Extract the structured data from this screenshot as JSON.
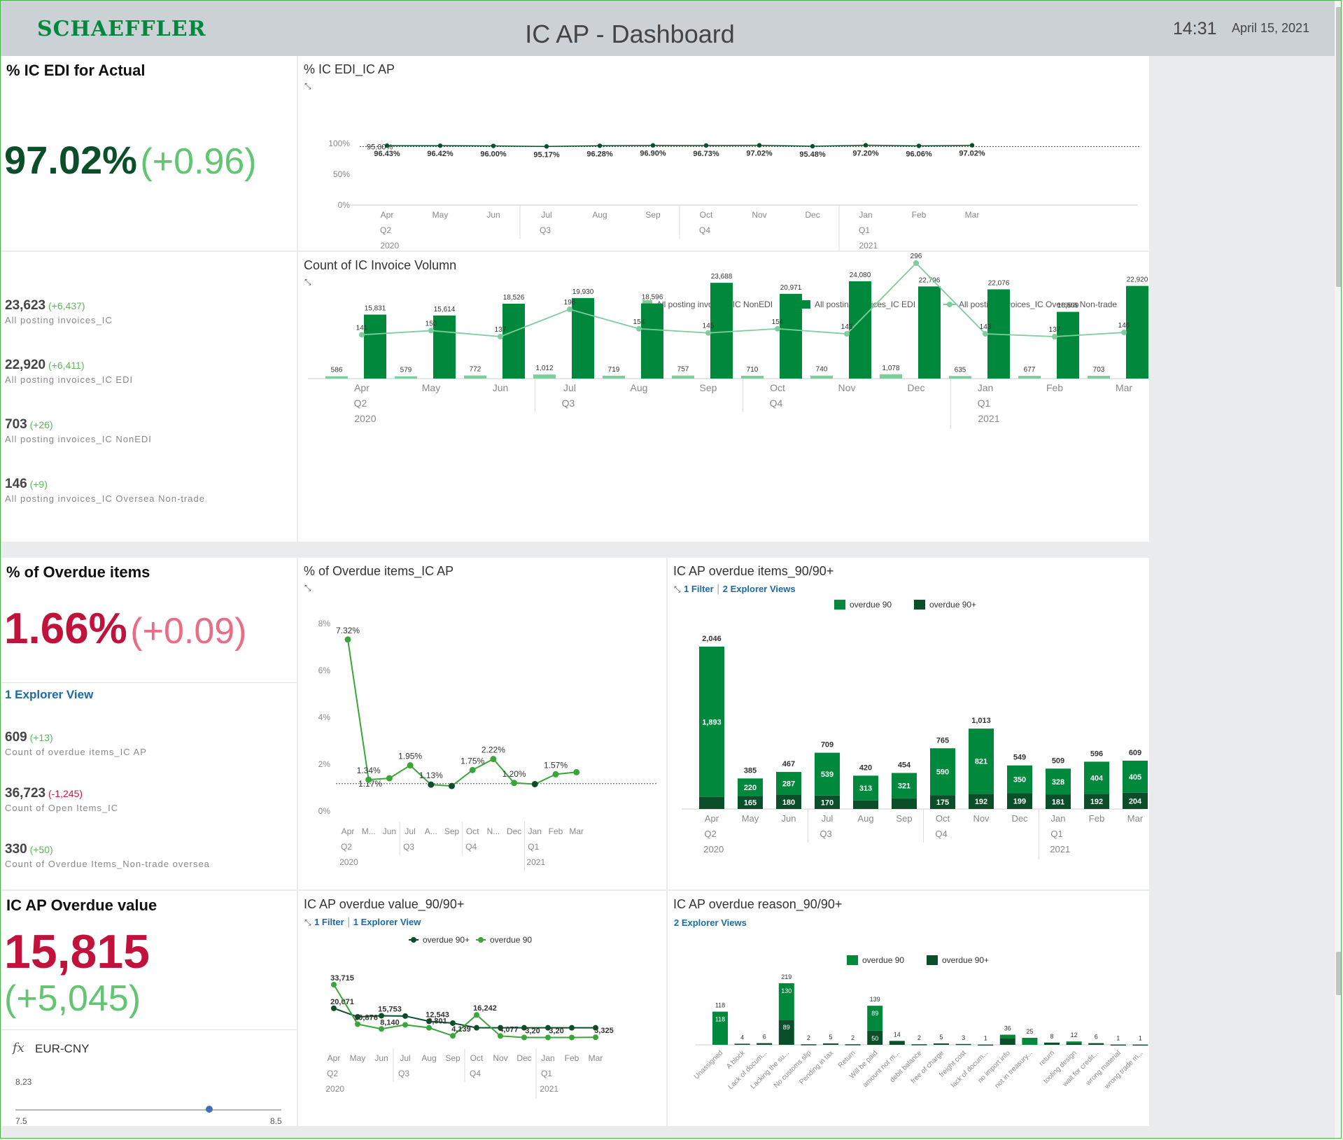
{
  "header": {
    "logo": "SCHAEFFLER",
    "title": "IC AP - Dashboard",
    "time": "14:31",
    "date": "April 15, 2021"
  },
  "colors": {
    "dark_green": "#0b6830",
    "green": "#00893d",
    "light_green": "#7fcc9c",
    "kpi_red": "#c0123a",
    "pos_green": "#63c471"
  },
  "kpi_edi": {
    "title": "% IC EDI for Actual",
    "value": "97.02%",
    "delta": "(+0.96)"
  },
  "edi_stats": [
    {
      "value": "23,623",
      "delta": "(+6,437)",
      "label": "All posting invoices_IC"
    },
    {
      "value": "22,920",
      "delta": "(+6,411)",
      "label": "All posting invoices_IC EDI"
    },
    {
      "value": "703",
      "delta": "(+26)",
      "label": "All posting invoices_IC NonEDI"
    },
    {
      "value": "146",
      "delta": "(+9)",
      "label": "All posting invoices_IC Oversea Non-trade"
    }
  ],
  "kpi_overdue": {
    "title": "% of Overdue items",
    "value": "1.66%",
    "delta": "(+0.09)",
    "link": "1 Explorer View"
  },
  "overdue_stats": [
    {
      "value": "609",
      "delta": "(+13)",
      "negative": false,
      "label": "Count of overdue items_IC AP"
    },
    {
      "value": "36,723",
      "delta": "(-1,245)",
      "negative": true,
      "label": "Count of Open Items_IC"
    },
    {
      "value": "330",
      "delta": "(+50)",
      "negative": false,
      "label": "Count of Overdue Items_Non-trade oversea"
    }
  ],
  "kpi_value": {
    "title": "IC AP Overdue value",
    "value": "15,815",
    "delta": "(+5,045)"
  },
  "fx": {
    "icon": "fx-icon",
    "label": "EUR-CNY",
    "value": "8.23",
    "min": "7.5",
    "max": "8.5",
    "level": 0.73
  },
  "chart_data": [
    {
      "id": "edi_pct",
      "title": "% IC EDI_IC AP",
      "type": "line",
      "categories": [
        "Apr",
        "May",
        "Jun",
        "Jul",
        "Aug",
        "Sep",
        "Oct",
        "Nov",
        "Dec",
        "Jan",
        "Feb",
        "Mar"
      ],
      "quarters": [
        "Q2",
        "Q3",
        "Q4",
        "Q1"
      ],
      "years": [
        "2020",
        "2021"
      ],
      "values": [
        96.43,
        96.42,
        96.0,
        95.17,
        96.28,
        96.9,
        96.73,
        97.02,
        95.48,
        97.2,
        96.06,
        97.02
      ],
      "labels": [
        "96.43%",
        "96.42%",
        "96.00%",
        "95.17%",
        "96.28%",
        "96.90%",
        "96.73%",
        "97.02%",
        "95.48%",
        "97.20%",
        "96.06%",
        "97.02%"
      ],
      "target": 95,
      "target_label": "95.00%",
      "yticks": [
        "100%",
        "50%",
        "0%"
      ],
      "ylim": [
        0,
        100
      ]
    },
    {
      "id": "invoice_volume",
      "title": "Count of IC Invoice Volumn",
      "type": "bar",
      "categories": [
        "Apr",
        "May",
        "Jun",
        "Jul",
        "Aug",
        "Sep",
        "Oct",
        "Nov",
        "Dec",
        "Jan",
        "Feb",
        "Mar"
      ],
      "quarters": [
        "Q2",
        "Q3",
        "Q4",
        "Q1"
      ],
      "years": [
        "2020",
        "2021"
      ],
      "series": [
        {
          "name": "All posting invoices_IC NonEDI",
          "values": [
            586,
            579,
            772,
            1012,
            719,
            757,
            710,
            740,
            1078,
            635,
            677,
            703
          ],
          "labels": [
            "586",
            "579",
            "772",
            "1,012",
            "719",
            "757",
            "710",
            "740",
            "1,078",
            "635",
            "677",
            "703"
          ]
        },
        {
          "name": "All posting invoices_IC EDI",
          "values": [
            15831,
            15614,
            18526,
            19930,
            18596,
            23688,
            20971,
            24080,
            22796,
            22076,
            16509,
            22920
          ],
          "labels": [
            "15,831",
            "15,614",
            "18,526",
            "19,930",
            "18,596",
            "23,688",
            "20,971",
            "24,080",
            "22,796",
            "22,076",
            "16,509",
            "22,920"
          ]
        },
        {
          "name": "All posting invoices_IC Oversea Non-trade",
          "values": [
            141,
            150,
            137,
            196,
            154,
            145,
            154,
            143,
            296,
            143,
            137,
            146
          ]
        }
      ]
    },
    {
      "id": "overdue_pct",
      "title": "% of Overdue items_IC AP",
      "type": "line",
      "categories": [
        "Apr",
        "M...",
        "Jun",
        "Jul",
        "A...",
        "Sep",
        "Oct",
        "N...",
        "Dec",
        "Jan",
        "Feb",
        "Mar"
      ],
      "quarters": [
        "Q2",
        "Q3",
        "Q4",
        "Q1"
      ],
      "years": [
        "2020",
        "2021"
      ],
      "values": [
        7.32,
        1.34,
        1.4,
        1.95,
        1.13,
        1.07,
        1.75,
        2.22,
        1.2,
        1.15,
        1.57,
        1.66
      ],
      "labels": [
        "7.32%",
        "1.34%",
        "",
        "1.95%",
        "1.13%",
        "",
        "1.75%",
        "2.22%",
        "1.20%",
        "",
        "1.57%",
        ""
      ],
      "target": 1.17,
      "target_label": "1.17%",
      "yticks": [
        "8%",
        "6%",
        "4%",
        "2%",
        "0%"
      ],
      "ylim": [
        0,
        8
      ]
    },
    {
      "id": "overdue_items",
      "title": "IC AP overdue items_90/90+",
      "type": "bar",
      "filter_link": "1 Filter",
      "explorer_link": "2 Explorer Views",
      "categories": [
        "Apr",
        "May",
        "Jun",
        "Jul",
        "Aug",
        "Sep",
        "Oct",
        "Nov",
        "Dec",
        "Jan",
        "Feb",
        "Mar"
      ],
      "quarters": [
        "Q2",
        "Q3",
        "Q4",
        "Q1"
      ],
      "years": [
        "2020",
        "2021"
      ],
      "series": [
        {
          "name": "overdue 90",
          "values": [
            1893,
            220,
            287,
            539,
            313,
            321,
            590,
            821,
            350,
            328,
            404,
            405
          ]
        },
        {
          "name": "overdue 90+",
          "values": [
            153,
            165,
            180,
            170,
            107,
            133,
            175,
            192,
            199,
            181,
            192,
            204
          ]
        }
      ],
      "totals": [
        "2,046",
        "385",
        "467",
        "709",
        "420",
        "454",
        "765",
        "1,013",
        "549",
        "509",
        "596",
        "609"
      ],
      "top_labels": [
        "1,893",
        "220",
        "287",
        "539",
        "313",
        "321",
        "590",
        "821",
        "350",
        "328",
        "404",
        "405"
      ],
      "bottom_labels": [
        "",
        "165",
        "180",
        "170",
        "",
        "",
        "175",
        "192",
        "199",
        "181",
        "192",
        "204"
      ]
    },
    {
      "id": "overdue_value",
      "title": "IC AP overdue value_90/90+",
      "type": "line",
      "filter_link": "1 Filter",
      "explorer_link": "1 Explorer View",
      "categories": [
        "Apr",
        "May",
        "Jun",
        "Jul",
        "Aug",
        "Sep",
        "Oct",
        "Nov",
        "Dec",
        "Jan",
        "Feb",
        "Mar"
      ],
      "quarters": [
        "Q2",
        "Q3",
        "Q4",
        "Q1"
      ],
      "years": [
        "2020",
        "2021"
      ],
      "series": [
        {
          "name": "overdue 90+",
          "values": [
            20071,
            15100,
            15753,
            15600,
            12543,
            11500,
            8801,
            8801,
            8801,
            8801,
            8801,
            8801
          ],
          "labels": [
            "20,071",
            "",
            "15,753",
            "",
            "12,543",
            "",
            "",
            "",
            "",
            "",
            "",
            ""
          ]
        },
        {
          "name": "overdue 90",
          "values": [
            33715,
            10876,
            8140,
            10500,
            8801,
            4139,
            16242,
            4077,
            3200,
            3200,
            3200,
            3325
          ],
          "labels": [
            "33,715",
            "10,876",
            "8,140",
            "",
            "8,801",
            "4,139",
            "16,242",
            "4,077",
            "3,20",
            "3,20",
            "",
            "3,325"
          ]
        }
      ]
    },
    {
      "id": "overdue_reason",
      "title": "IC AP overdue reason_90/90+",
      "type": "bar",
      "explorer_link": "2 Explorer Views",
      "categories": [
        "Unassigned",
        "A block",
        "Lack of docum...",
        "Lacking the su...",
        "No customs slip",
        "Pending in tax",
        "Return",
        "Will be paid",
        "amount not m...",
        "debit balance",
        "free of charge",
        "freight cost",
        "lack of docum...",
        "no import info",
        "not in treasury...",
        "return",
        "tooling design",
        "wait for credit...",
        "wrong material",
        "wrong trade m..."
      ],
      "series": [
        {
          "name": "overdue 90",
          "values": [
            118,
            0,
            0,
            130,
            0,
            0,
            0,
            89,
            0,
            0,
            0,
            0,
            0,
            12,
            25,
            0,
            6,
            0,
            0,
            0
          ]
        },
        {
          "name": "overdue 90+",
          "values": [
            0,
            4,
            6,
            89,
            2,
            5,
            2,
            50,
            14,
            2,
            5,
            3,
            1,
            24,
            0,
            8,
            6,
            6,
            1,
            1
          ]
        }
      ],
      "totals": [
        "118",
        "4",
        "6",
        "219",
        "2",
        "5",
        "2",
        "139",
        "14",
        "2",
        "5",
        "3",
        "1",
        "36",
        "25",
        "8",
        "12",
        "6",
        "1",
        "1"
      ],
      "inner_labels": [
        "118",
        "",
        "",
        "130",
        "",
        "",
        "",
        "89",
        "",
        "",
        "",
        "",
        "",
        "",
        "",
        "",
        "",
        "",
        "",
        ""
      ],
      "dark_labels": [
        "",
        "",
        "",
        "89",
        "",
        "",
        "",
        "50",
        "",
        "",
        "",
        "",
        "",
        "",
        "",
        "",
        "",
        "",
        "",
        ""
      ]
    }
  ]
}
